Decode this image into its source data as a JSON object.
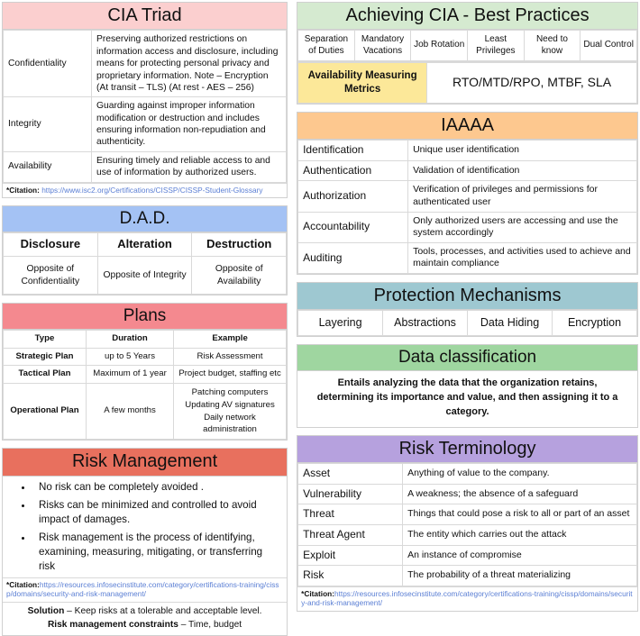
{
  "colors": {
    "cia_header": "#fbcfcf",
    "dad_header": "#a4c2f4",
    "plans_header": "#f4898f",
    "risk_mgmt_header": "#e8705e",
    "achieving_cia_header": "#d5ead0",
    "availability_label": "#fce899",
    "iaaaa_header": "#fdc88f",
    "protection_header": "#9ec8d1",
    "data_classification_header": "#9fd6a0",
    "risk_terminology_header": "#b6a1de",
    "link": "#5b7fd4"
  },
  "cia_triad": {
    "title": "CIA Triad",
    "rows": [
      {
        "term": "Confidentiality",
        "definition": "Preserving authorized restrictions on information access and disclosure, including means for protecting personal privacy and proprietary information. Note – Encryption (At transit – TLS) (At rest - AES – 256)"
      },
      {
        "term": "Integrity",
        "definition": "Guarding against improper information modification or destruction and includes ensuring information non-repudiation and authenticity."
      },
      {
        "term": "Availability",
        "definition": "Ensuring timely and reliable access to and use of information by authorized users."
      }
    ],
    "citation_label": "*Citation:",
    "citation_url": "https://www.isc2.org/Certifications/CISSP/CISSP-Student-Glossary"
  },
  "dad": {
    "title": "D.A.D.",
    "headers": [
      "Disclosure",
      "Alteration",
      "Destruction"
    ],
    "values": [
      "Opposite of Confidentiality",
      "Opposite of Integrity",
      "Opposite of Availability"
    ]
  },
  "plans": {
    "title": "Plans",
    "headers": [
      "Type",
      "Duration",
      "Example"
    ],
    "rows": [
      {
        "type": "Strategic Plan",
        "duration": "up to 5 Years",
        "example": "Risk Assessment"
      },
      {
        "type": "Tactical Plan",
        "duration": "Maximum of 1 year",
        "example": "Project budget, staffing etc"
      },
      {
        "type": "Operational Plan",
        "duration": "A few months",
        "example": "Patching computers\nUpdating AV signatures\nDaily network administration"
      }
    ]
  },
  "risk_management": {
    "title": "Risk Management",
    "bullets": [
      "No risk can be completely avoided .",
      "Risks can be minimized and controlled to avoid impact of damages.",
      "Risk management is the process of identifying, examining, measuring, mitigating, or transferring risk"
    ],
    "citation_label": "*Citation:",
    "citation_url": "https://resources.infosecinstitute.com/category/certifications-training/cissp/domains/security-and-risk-management/",
    "footer_solution_label": "Solution",
    "footer_solution_text": " – Keep risks at a tolerable and acceptable level.",
    "footer_constraints_label": "Risk management constraints",
    "footer_constraints_text": " – Time, budget"
  },
  "achieving_cia": {
    "title": "Achieving CIA - Best Practices",
    "practices": [
      "Separation of Duties",
      "Mandatory Vacations",
      "Job Rotation",
      "Least Privileges",
      "Need to know",
      "Dual Control"
    ],
    "availability_label": "Availability Measuring Metrics",
    "availability_value": "RTO/MTD/RPO, MTBF, SLA"
  },
  "iaaaa": {
    "title": "IAAAA",
    "rows": [
      {
        "term": "Identification",
        "definition": "Unique user identification"
      },
      {
        "term": "Authentication",
        "definition": "Validation of identification"
      },
      {
        "term": "Authorization",
        "definition": "Verification of privileges and permissions for authenticated user"
      },
      {
        "term": "Accountability",
        "definition": "Only authorized users are accessing and use the system accordingly"
      },
      {
        "term": "Auditing",
        "definition": "Tools, processes, and activities used to achieve and maintain compliance"
      }
    ]
  },
  "protection_mechanisms": {
    "title": "Protection Mechanisms",
    "items": [
      "Layering",
      "Abstractions",
      "Data Hiding",
      "Encryption"
    ]
  },
  "data_classification": {
    "title": "Data classification",
    "body": "Entails analyzing the data that the organization retains, determining its importance and value, and then assigning it to a category."
  },
  "risk_terminology": {
    "title": "Risk Terminology",
    "rows": [
      {
        "term": "Asset",
        "definition": "Anything of value to the company."
      },
      {
        "term": "Vulnerability",
        "definition": "A weakness; the absence of a safeguard"
      },
      {
        "term": "Threat",
        "definition": "Things that could pose a risk to all or part of an asset"
      },
      {
        "term": "Threat Agent",
        "definition": "The entity which carries out the attack"
      },
      {
        "term": "Exploit",
        "definition": "An instance of compromise"
      },
      {
        "term": "Risk",
        "definition": "The probability of a threat materializing"
      }
    ],
    "citation_label": "*Citation:",
    "citation_url": "https://resources.infosecinstitute.com/category/certifications-training/cissp/domains/security-and-risk-management/"
  }
}
